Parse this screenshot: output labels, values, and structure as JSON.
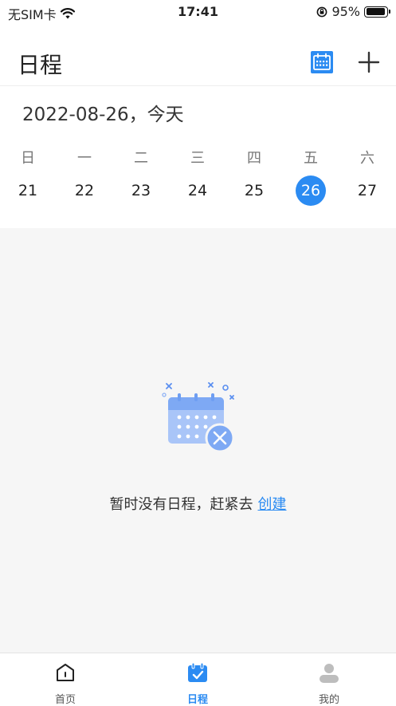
{
  "status_bar": {
    "carrier": "无SIM卡",
    "time": "17:41",
    "battery": "95%",
    "battery_level": 0.95
  },
  "header": {
    "title": "日程",
    "calendar_icon": "calendar-icon",
    "add_icon": "plus-icon"
  },
  "date_heading": "2022-08-26，今天",
  "week": {
    "weekdays": [
      "日",
      "一",
      "二",
      "三",
      "四",
      "五",
      "六"
    ],
    "days": [
      "21",
      "22",
      "23",
      "24",
      "25",
      "26",
      "27"
    ],
    "selected_day": "26"
  },
  "empty_state": {
    "message": "暂时没有日程，赶紧去",
    "link": "创建"
  },
  "tabbar": {
    "tabs": [
      {
        "label": "首页",
        "icon": "home-icon"
      },
      {
        "label": "日程",
        "icon": "calendar-check-icon"
      },
      {
        "label": "我的",
        "icon": "user-icon"
      }
    ],
    "active": "日程"
  },
  "colors": {
    "accent": "#2b8bf2",
    "background": "#f6f6f6"
  }
}
